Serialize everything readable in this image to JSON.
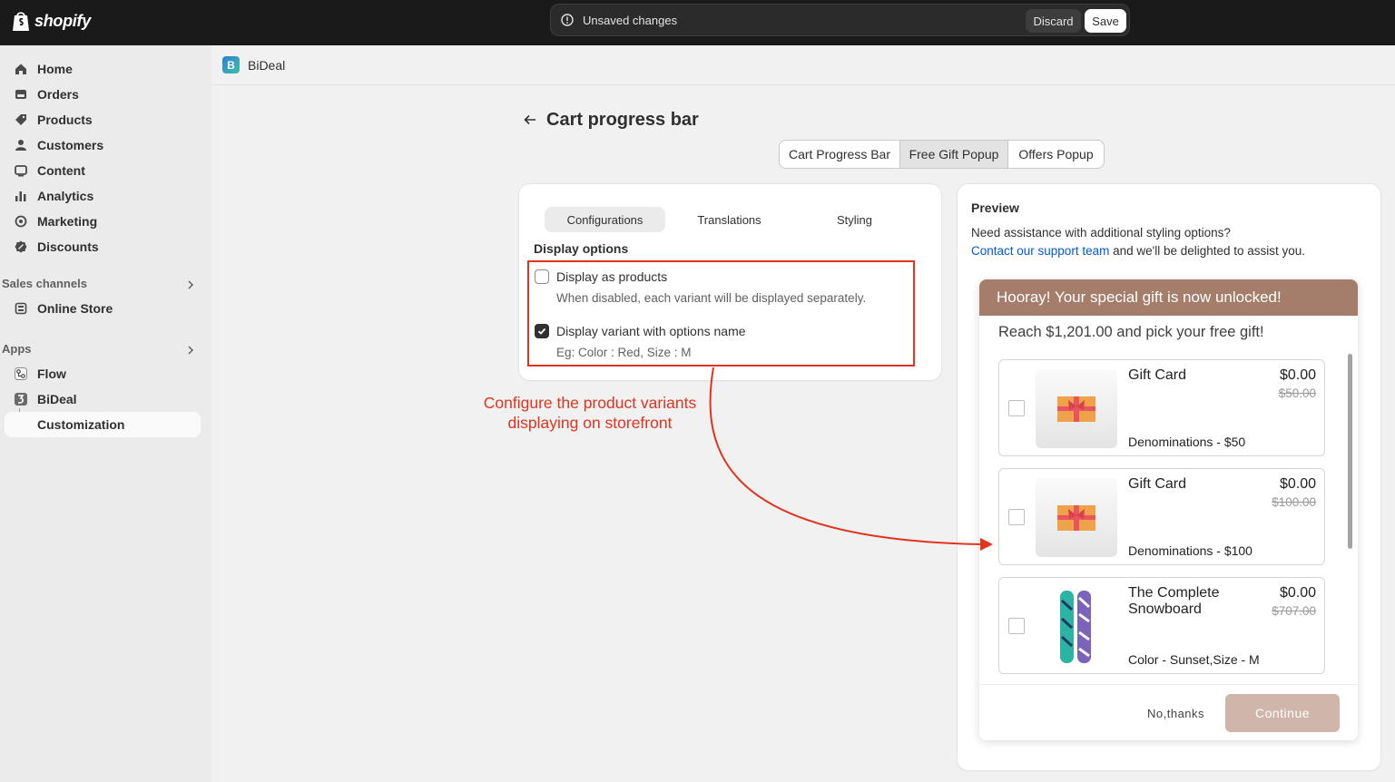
{
  "topbar": {
    "brand": "shopify",
    "unsaved_message": "Unsaved changes",
    "discard_label": "Discard",
    "save_label": "Save"
  },
  "sidebar": {
    "items": [
      {
        "label": "Home",
        "icon": "home-icon"
      },
      {
        "label": "Orders",
        "icon": "orders-icon"
      },
      {
        "label": "Products",
        "icon": "tag-icon"
      },
      {
        "label": "Customers",
        "icon": "person-icon"
      },
      {
        "label": "Content",
        "icon": "content-icon"
      },
      {
        "label": "Analytics",
        "icon": "bar-chart-icon"
      },
      {
        "label": "Marketing",
        "icon": "target-icon"
      },
      {
        "label": "Discounts",
        "icon": "discount-icon"
      }
    ],
    "sales_channels_label": "Sales channels",
    "online_store_label": "Online Store",
    "apps_label": "Apps",
    "flow_label": "Flow",
    "bideal_label": "BiDeal",
    "customization_label": "Customization"
  },
  "appbar": {
    "app_name": "BiDeal"
  },
  "page": {
    "title": "Cart progress bar",
    "segments": [
      "Cart Progress Bar",
      "Free Gift Popup",
      "Offers Popup"
    ],
    "selected_segment": "Free Gift Popup"
  },
  "config": {
    "tabs": [
      "Configurations",
      "Translations",
      "Styling"
    ],
    "selected_tab": "Configurations",
    "section_title": "Display options",
    "option1_label": "Display as products",
    "option1_checked": false,
    "option1_help": "When disabled, each variant will be displayed separately.",
    "option2_label": "Display variant with options name",
    "option2_checked": true,
    "option2_help": "Eg: Color : Red, Size : M"
  },
  "annotation": {
    "line1": "Configure the product variants",
    "line2": "displaying on storefront",
    "color": "#e0341f"
  },
  "preview": {
    "title": "Preview",
    "need_text": "Need assistance with additional styling options?",
    "contact_link": "Contact our support team",
    "contact_rest": " and we'll be delighted to assist you.",
    "popup": {
      "header": "Hooray! Your special gift is now unlocked!",
      "header_color": "#a47d6b",
      "reach_text": "Reach $1,201.00 and pick your free gift!",
      "items": [
        {
          "name": "Gift Card",
          "price": "$0.00",
          "compare_price": "$50.00",
          "variant": "Denominations - $50",
          "image": "gift-card-image"
        },
        {
          "name": "Gift Card",
          "price": "$0.00",
          "compare_price": "$100.00",
          "variant": "Denominations - $100",
          "image": "gift-card-image"
        },
        {
          "name": "The Complete Snowboard",
          "price": "$0.00",
          "compare_price": "$707.00",
          "variant": "Color - Sunset,Size - M",
          "image": "snowboard-image"
        }
      ],
      "no_thanks": "No,thanks",
      "continue": "Continue"
    }
  }
}
